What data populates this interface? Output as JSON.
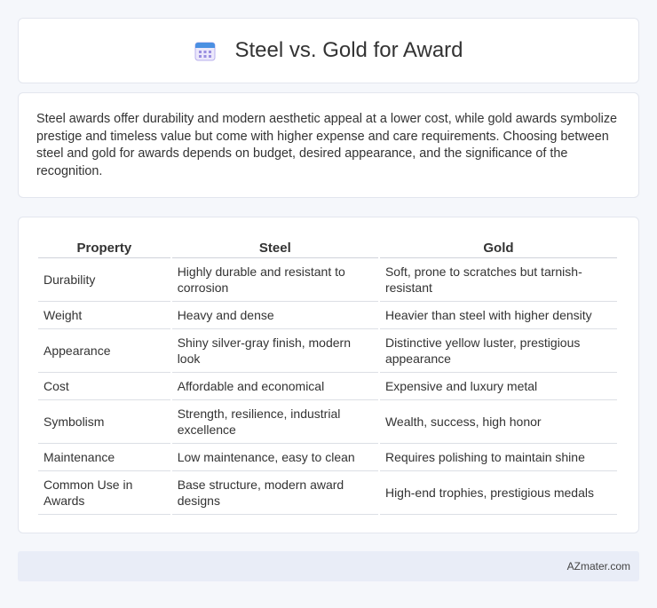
{
  "header": {
    "title": "Steel vs. Gold for Award",
    "icon": "calendar-icon"
  },
  "summary": {
    "text": "Steel awards offer durability and modern aesthetic appeal at a lower cost, while gold awards symbolize prestige and timeless value but come with higher expense and care requirements. Choosing between steel and gold for awards depends on budget, desired appearance, and the significance of the recognition."
  },
  "table": {
    "headers": [
      "Property",
      "Steel",
      "Gold"
    ],
    "rows": [
      [
        "Durability",
        "Highly durable and resistant to corrosion",
        "Soft, prone to scratches but tarnish-resistant"
      ],
      [
        "Weight",
        "Heavy and dense",
        "Heavier than steel with higher density"
      ],
      [
        "Appearance",
        "Shiny silver-gray finish, modern look",
        "Distinctive yellow luster, prestigious appearance"
      ],
      [
        "Cost",
        "Affordable and economical",
        "Expensive and luxury metal"
      ],
      [
        "Symbolism",
        "Strength, resilience, industrial excellence",
        "Wealth, success, high honor"
      ],
      [
        "Maintenance",
        "Low maintenance, easy to clean",
        "Requires polishing to maintain shine"
      ],
      [
        "Common Use in Awards",
        "Base structure, modern award designs",
        "High-end trophies, prestigious medals"
      ]
    ]
  },
  "footer": {
    "text": "AZmater.com"
  },
  "colors": {
    "background": "#f5f7fb",
    "footer_bg": "#e9edf7",
    "icon_purple": "#8b7fd6",
    "icon_blue": "#4a90e2"
  }
}
